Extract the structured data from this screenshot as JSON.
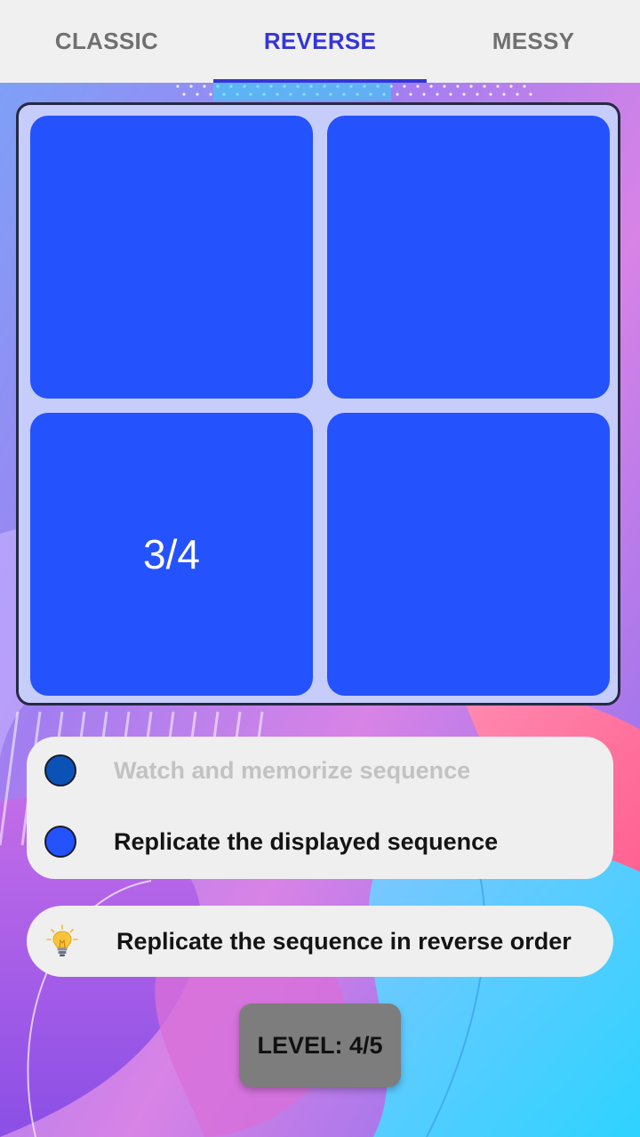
{
  "tabs": [
    {
      "label": "CLASSIC",
      "active": false
    },
    {
      "label": "REVERSE",
      "active": true
    },
    {
      "label": "MESSY",
      "active": false
    }
  ],
  "board": {
    "tile_color": "#2452fc",
    "tiles": [
      "",
      "",
      "3/4",
      ""
    ]
  },
  "steps": [
    {
      "text": "Watch and memorize sequence",
      "state": "inactive",
      "dot_color": "#0b52b7"
    },
    {
      "text": "Replicate the displayed sequence",
      "state": "active",
      "dot_color": "#2452fc"
    }
  ],
  "hint": {
    "icon": "lightbulb-icon",
    "text": "Replicate the sequence in reverse order"
  },
  "level": {
    "label": "LEVEL: 4/5"
  },
  "colors": {
    "accent": "#3535d8",
    "card_bg": "#efefef",
    "board_bg": "#c6cdfb"
  }
}
